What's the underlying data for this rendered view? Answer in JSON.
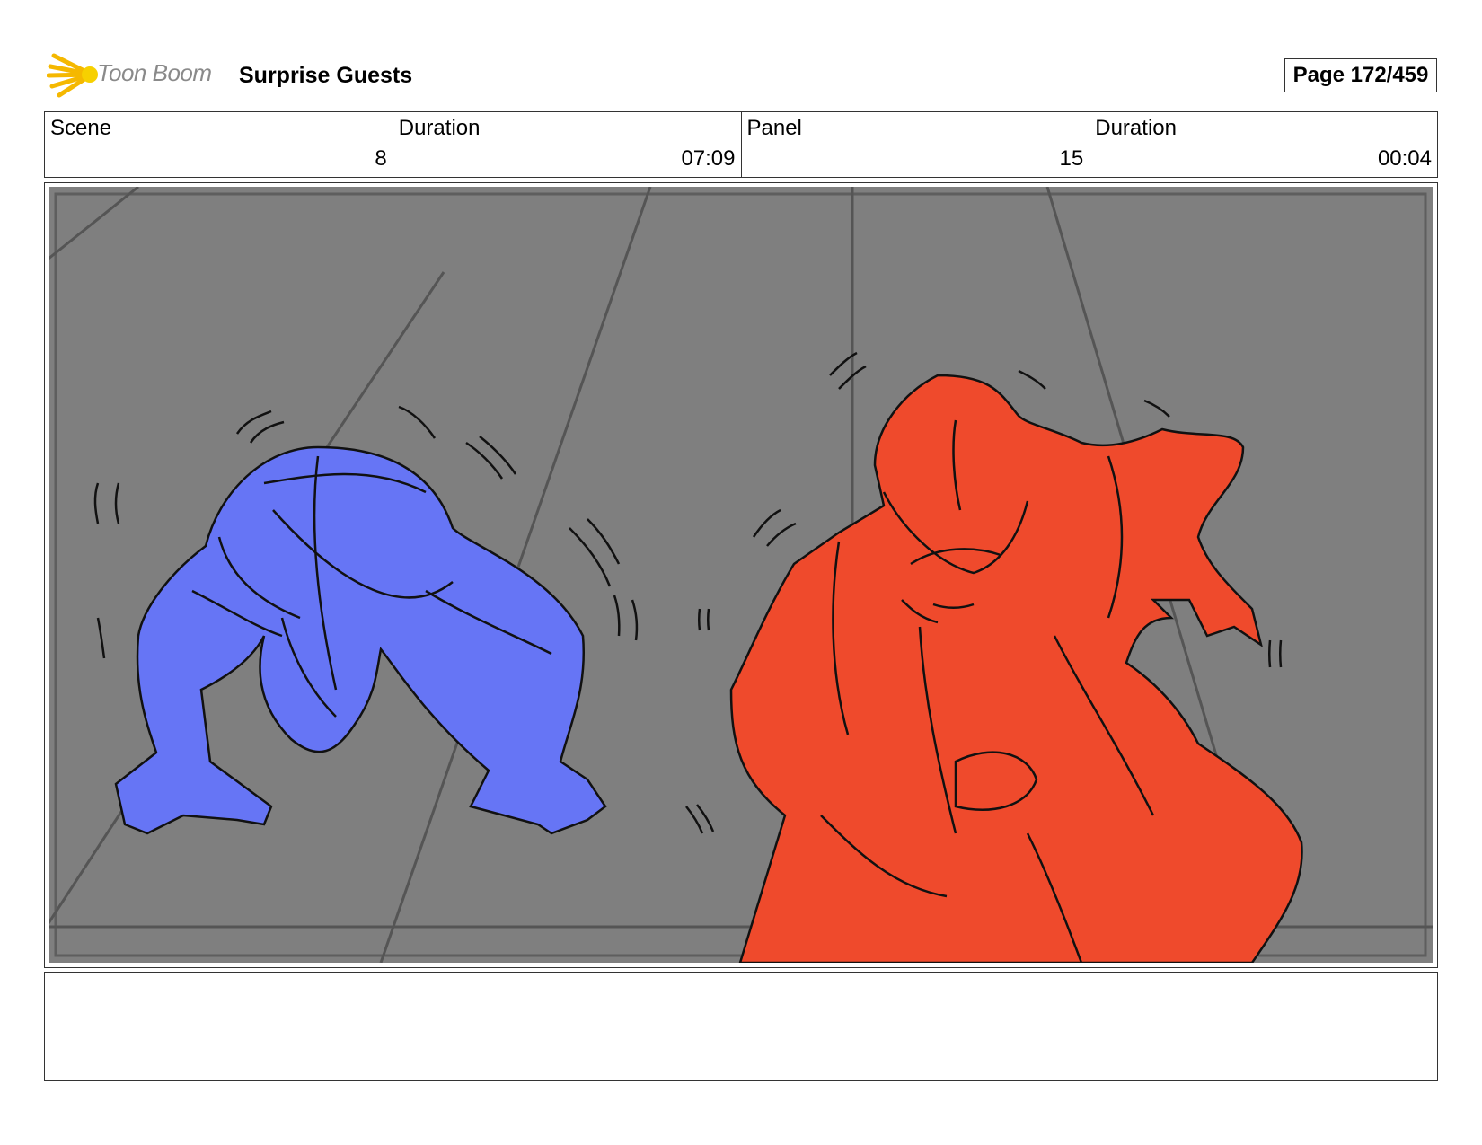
{
  "header": {
    "logo_text": "Toon Boom",
    "title": "Surprise Guests",
    "page_label": "Page 172/459"
  },
  "info": {
    "scene_label": "Scene",
    "scene_value": "8",
    "scene_duration_label": "Duration",
    "scene_duration_value": "07:09",
    "panel_label": "Panel",
    "panel_value": "15",
    "panel_duration_label": "Duration",
    "panel_duration_value": "00:04"
  },
  "colors": {
    "background_gray": "#7f7f7f",
    "blue_figure": "#6675f5",
    "red_figure": "#ef4a2c",
    "logo_yellow": "#f5c518"
  },
  "notes": {
    "text": ""
  }
}
